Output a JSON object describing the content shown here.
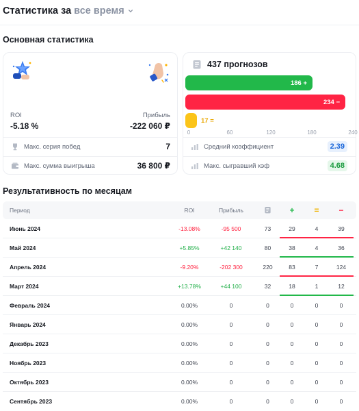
{
  "header": {
    "title": "Статистика за",
    "period": "все время"
  },
  "main_stats": {
    "title": "Основная статистика",
    "roi_label": "ROI",
    "roi_value": "-5.18 %",
    "profit_label": "Прибыль",
    "profit_value": "-222 060 ₽",
    "win_streak_label": "Макс. серия побед",
    "win_streak_value": "7",
    "max_win_label": "Макс. сумма выигрыша",
    "max_win_value": "36 800 ₽"
  },
  "predictions": {
    "title": "437 прогнозов",
    "wins_label": "186 +",
    "losses_label": "234 −",
    "draws_label": "17 =",
    "ticks": [
      "0",
      "60",
      "120",
      "180",
      "240"
    ],
    "avg_coef_label": "Средний коэффициент",
    "avg_coef_value": "2.39",
    "max_coef_label": "Макс. сыгравший кэф",
    "max_coef_value": "4.68"
  },
  "chart_data": {
    "type": "bar",
    "categories": [
      "+",
      "−",
      "="
    ],
    "values": [
      186,
      234,
      17
    ],
    "xlim": [
      0,
      240
    ]
  },
  "monthly": {
    "title": "Результативность по месяцам",
    "headers": {
      "period": "Период",
      "roi": "ROI",
      "profit": "Прибыль",
      "win": "+",
      "draw": "=",
      "loss": "−"
    },
    "rows": [
      {
        "period": "Июнь 2024",
        "roi": "-13.08%",
        "profit": "-95 500",
        "n": "73",
        "w": "29",
        "d": "4",
        "l": "39",
        "trend": "neg"
      },
      {
        "period": "Май 2024",
        "roi": "+5.85%",
        "profit": "+42 140",
        "n": "80",
        "w": "38",
        "d": "4",
        "l": "36",
        "trend": "pos"
      },
      {
        "period": "Апрель 2024",
        "roi": "-9.20%",
        "profit": "-202 300",
        "n": "220",
        "w": "83",
        "d": "7",
        "l": "124",
        "trend": "neg"
      },
      {
        "period": "Март 2024",
        "roi": "+13.78%",
        "profit": "+44 100",
        "n": "32",
        "w": "18",
        "d": "1",
        "l": "12",
        "trend": "pos"
      },
      {
        "period": "Февраль 2024",
        "roi": "0.00%",
        "profit": "0",
        "n": "0",
        "w": "0",
        "d": "0",
        "l": "0",
        "trend": "zero"
      },
      {
        "period": "Январь 2024",
        "roi": "0.00%",
        "profit": "0",
        "n": "0",
        "w": "0",
        "d": "0",
        "l": "0",
        "trend": "zero"
      },
      {
        "period": "Декабрь 2023",
        "roi": "0.00%",
        "profit": "0",
        "n": "0",
        "w": "0",
        "d": "0",
        "l": "0",
        "trend": "zero"
      },
      {
        "period": "Ноябрь 2023",
        "roi": "0.00%",
        "profit": "0",
        "n": "0",
        "w": "0",
        "d": "0",
        "l": "0",
        "trend": "zero"
      },
      {
        "period": "Октябрь 2023",
        "roi": "0.00%",
        "profit": "0",
        "n": "0",
        "w": "0",
        "d": "0",
        "l": "0",
        "trend": "zero"
      },
      {
        "period": "Сентябрь 2023",
        "roi": "0.00%",
        "profit": "0",
        "n": "0",
        "w": "0",
        "d": "0",
        "l": "0",
        "trend": "zero"
      }
    ]
  },
  "colors": {
    "green": "#22b84a",
    "red": "#ff2444",
    "yellow": "#fbc419",
    "blue": "#1a66d9"
  }
}
